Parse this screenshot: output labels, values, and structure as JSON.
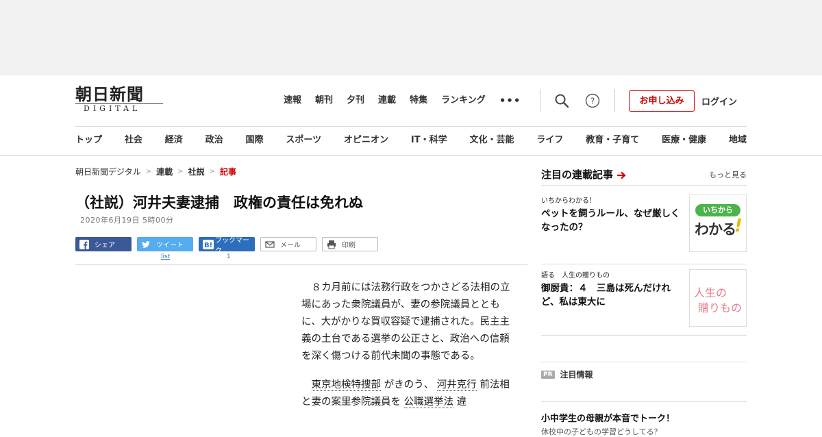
{
  "logo": {
    "jp": "朝日新聞",
    "en": "DIGITAL"
  },
  "topnav": [
    "速報",
    "朝刊",
    "夕刊",
    "連載",
    "特集",
    "ランキング"
  ],
  "more_label": "•••",
  "apply_label": "お申し込み",
  "login_label": "ログイン",
  "categories": [
    "トップ",
    "社会",
    "経済",
    "政治",
    "国際",
    "スポーツ",
    "オピニオン",
    "IT・科学",
    "文化・芸能",
    "ライフ",
    "教育・子育て",
    "医療・健康",
    "地域"
  ],
  "breadcrumb": [
    "朝日新聞デジタル",
    "連載",
    "社説",
    "記事"
  ],
  "article": {
    "title": "（社説）河井夫妻逮捕　政権の責任は免れぬ",
    "date": "2020年6月19日 5時00分",
    "paragraph1": "８カ月前には法務行政をつかさどる法相の立場にあった衆院議員が、妻の参院議員とともに、大がかりな買収容疑で逮捕された。民主主義の土台である選挙の公正さと、政治への信頼を深く傷つける前代未聞の事態である。",
    "p2_link1": "東京地検特捜部",
    "p2_text1": " がきのう、 ",
    "p2_link2": "河井克行",
    "p2_text2": " 前法相と妻の案里参院議員を ",
    "p2_link3": "公職選挙法",
    "p2_text3": " 違"
  },
  "share": {
    "facebook": "シェア",
    "twitter": "ツイート",
    "hatena": "ブックマーク",
    "mail": "メール",
    "print": "印刷",
    "twitter_count": "list",
    "hatena_count": "1"
  },
  "sidebar": {
    "title": "注目の連載記事",
    "more": "もっと見る",
    "cards": [
      {
        "kicker": "いちからわかる！",
        "title": "ペットを飼うルール、なぜ厳しくなったの？",
        "thumb_top": "いちから",
        "thumb_main": "わかる"
      },
      {
        "kicker": "語る　人生の贈りもの",
        "title": "御厨貴：４　三島は死んだけれど、私は東大に",
        "thumb_line1": "人生の",
        "thumb_line2": "贈りもの"
      }
    ],
    "pr_badge": "PR",
    "pr_label": "注目情報",
    "pr_title": "小中学生の母親が本音でトーク！",
    "pr_sub": "休校中の子どもの学習どうしてる？"
  },
  "colors": {
    "accent": "#cc0000",
    "facebook": "#3b5998",
    "twitter": "#55acee",
    "hatena": "#2c6ebd"
  }
}
